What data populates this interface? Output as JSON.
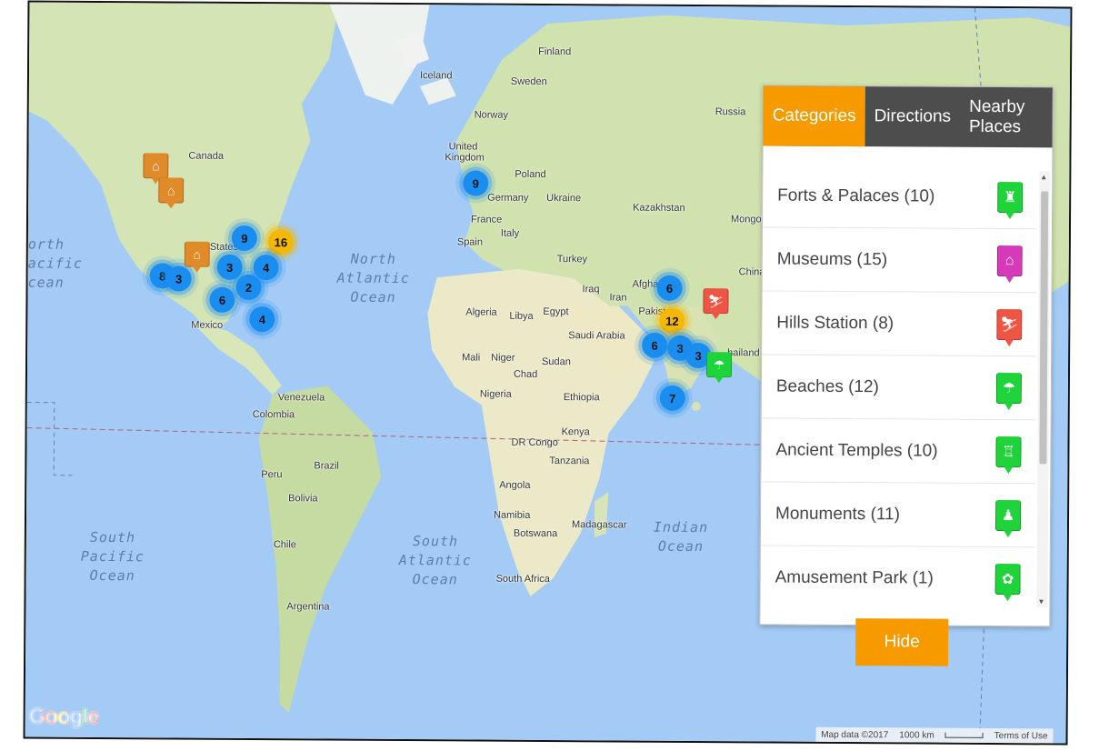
{
  "tabs": [
    {
      "label": "Categories",
      "active": true
    },
    {
      "label": "Directions",
      "active": false
    },
    {
      "label": "Nearby Places",
      "active": false
    }
  ],
  "categories": [
    {
      "label": "Forts & Palaces (10)",
      "icon": "fort-icon",
      "color": "#1fd43a",
      "glyph": "♜"
    },
    {
      "label": "Museums (15)",
      "icon": "museum-icon",
      "color": "#d63ab8",
      "glyph": "⌂"
    },
    {
      "label": "Hills Station (8)",
      "icon": "skiing-icon",
      "color": "#ee5544",
      "glyph": "⛷"
    },
    {
      "label": "Beaches (12)",
      "icon": "beach-umbrella-icon",
      "color": "#1fd43a",
      "glyph": "☂"
    },
    {
      "label": "Ancient Temples (10)",
      "icon": "temple-icon",
      "color": "#1fd43a",
      "glyph": "♖"
    },
    {
      "label": "Monuments (11)",
      "icon": "monument-icon",
      "color": "#1fd43a",
      "glyph": "♟"
    },
    {
      "label": "Amusement Park (1)",
      "icon": "amusement-park-icon",
      "color": "#1fd43a",
      "glyph": "✿"
    }
  ],
  "hide_label": "Hide",
  "clusters": [
    {
      "count": "9",
      "color": "blue"
    },
    {
      "count": "16",
      "color": "yellow"
    },
    {
      "count": "3",
      "color": "blue"
    },
    {
      "count": "4",
      "color": "blue"
    },
    {
      "count": "8",
      "color": "blue"
    },
    {
      "count": "3",
      "color": "blue"
    },
    {
      "count": "2",
      "color": "blue"
    },
    {
      "count": "6",
      "color": "blue"
    },
    {
      "count": "4",
      "color": "blue"
    },
    {
      "count": "9",
      "color": "blue"
    },
    {
      "count": "6",
      "color": "blue"
    },
    {
      "count": "12",
      "color": "yellow"
    },
    {
      "count": "6",
      "color": "blue"
    },
    {
      "count": "3",
      "color": "blue"
    },
    {
      "count": "3",
      "color": "blue"
    },
    {
      "count": "7",
      "color": "blue"
    }
  ],
  "map_markers": [
    {
      "name": "hotel-marker",
      "color": "#e08a2a",
      "glyph": "⌂"
    },
    {
      "name": "hotel-marker",
      "color": "#e08a2a",
      "glyph": "⌂"
    },
    {
      "name": "hotel-marker",
      "color": "#e08a2a",
      "glyph": "⌂"
    },
    {
      "name": "skiing-marker",
      "color": "#ee5544",
      "glyph": "⛷"
    },
    {
      "name": "beach-marker",
      "color": "#1fd43a",
      "glyph": "☂"
    }
  ],
  "place_labels": [
    "Finland",
    "Iceland",
    "Sweden",
    "Norway",
    "Russia",
    "United Kingdom",
    "Poland",
    "Germany",
    "Ukraine",
    "France",
    "Kazakhstan",
    "Mongolia",
    "Spain",
    "Italy",
    "Turkey",
    "China",
    "Canada",
    "States",
    "Mexico",
    "Iraq",
    "Iran",
    "Afghanist",
    "Pakist",
    "Algeria",
    "Libya",
    "Egypt",
    "Saudi Arabia",
    "Mali",
    "Niger",
    "Chad",
    "Sudan",
    "Nigeria",
    "Ethiopia",
    "Kenya",
    "DR Congo",
    "Tanzania",
    "Angola",
    "Namibia",
    "Botswana",
    "Madagascar",
    "South Africa",
    "Venezuela",
    "Colombia",
    "Peru",
    "Brazil",
    "Bolivia",
    "Chile",
    "Argentina",
    "hailand"
  ],
  "oceans": [
    "North\nAtlantic\nOcean",
    "South\nAtlantic\nOcean",
    "South\nPacific\nOcean",
    "Indian\nOcean",
    "orth\nacific\ncean"
  ],
  "google_logo": "Google",
  "attribution": {
    "map_data": "Map data ©2017",
    "scale": "1000 km",
    "terms": "Terms of Use"
  },
  "colors": {
    "accent": "#f79a00",
    "tab_bar": "#4d4d4d",
    "ocean": "#a3cbf5",
    "land": "#e8eac8",
    "vegetation": "#c9dfa8"
  }
}
